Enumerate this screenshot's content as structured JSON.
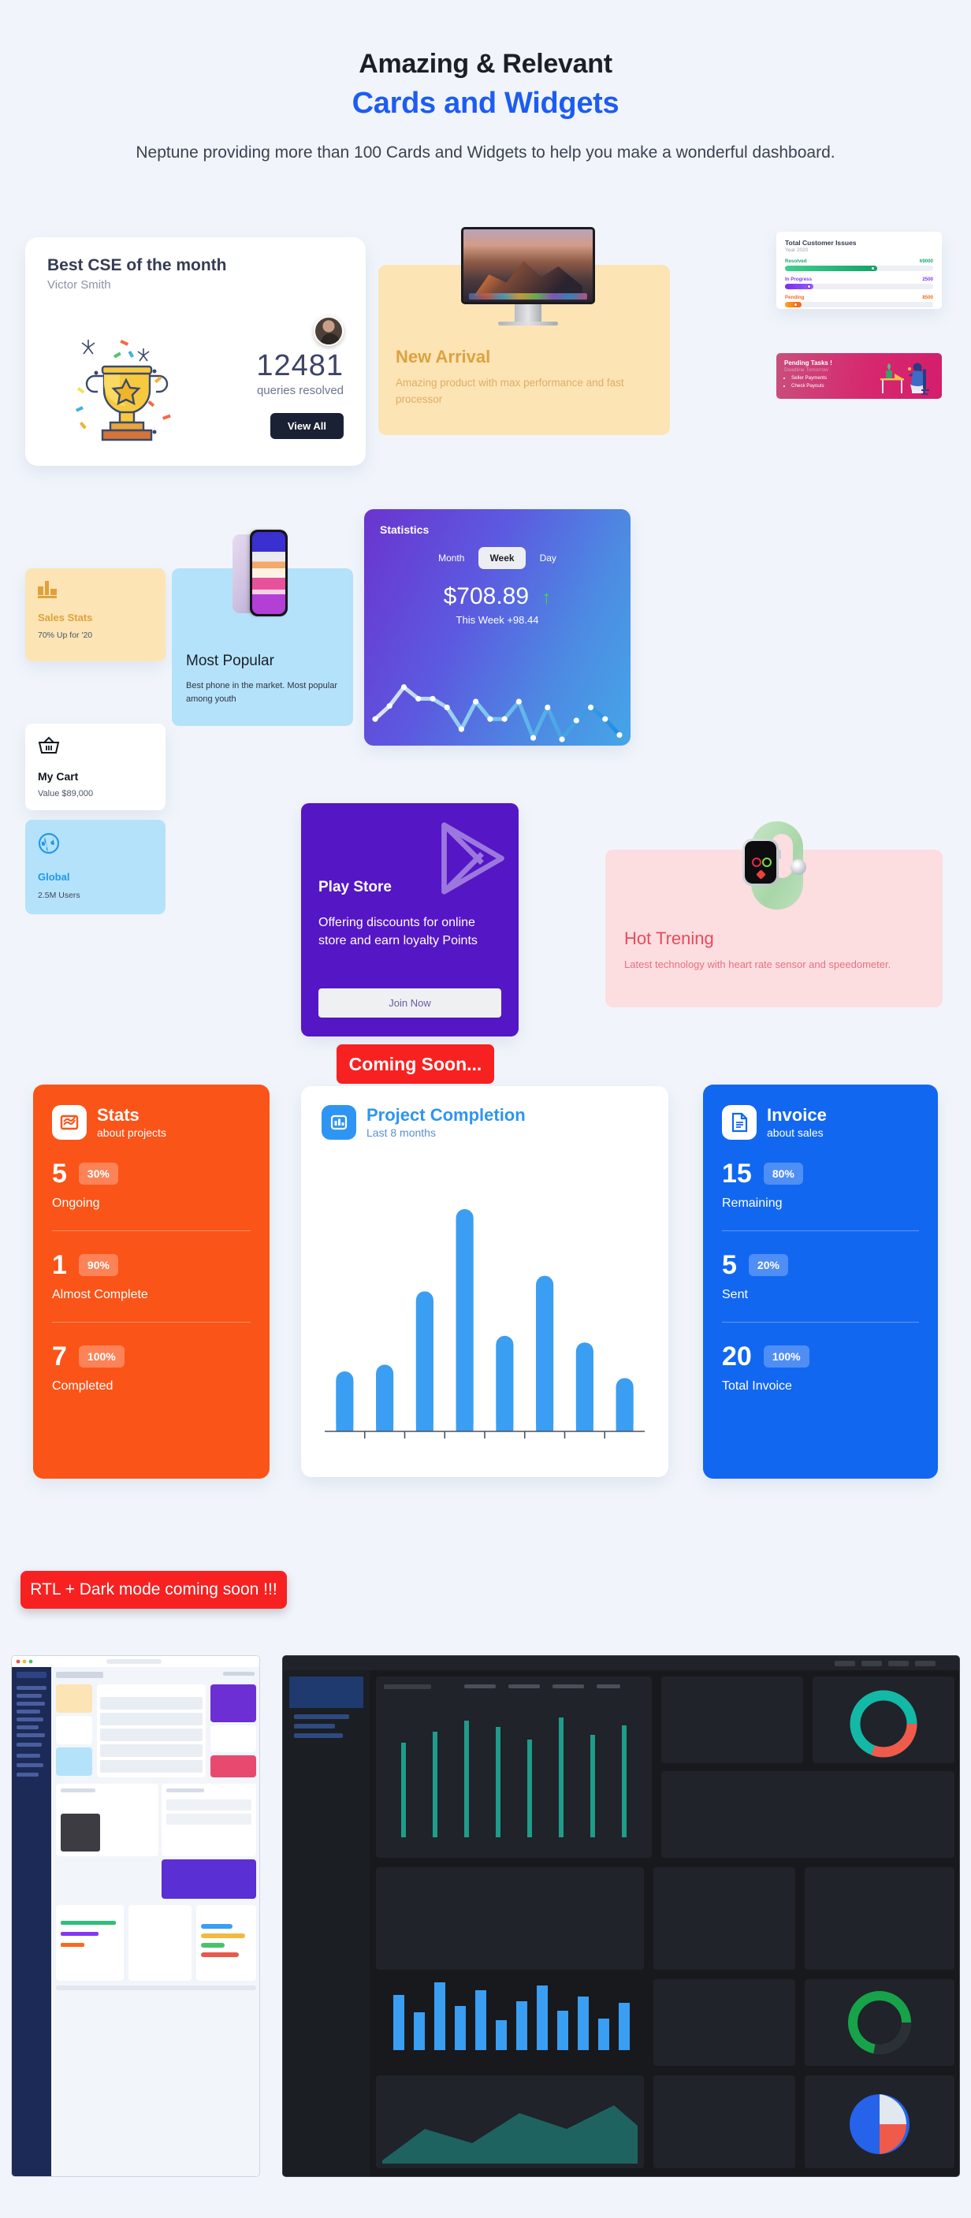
{
  "header": {
    "eyebrow": "Amazing & Relevant",
    "title": "Cards and Widgets",
    "description": "Neptune providing more than 100 Cards and Widgets to help you make a wonderful dashboard."
  },
  "cse_card": {
    "title": "Best CSE of the month",
    "name": "Victor Smith",
    "count": "12481",
    "count_label": "queries resolved",
    "button": "View All"
  },
  "new_arrival": {
    "title": "New Arrival",
    "description": "Amazing product with max performance and fast processor"
  },
  "issues_card": {
    "title": "Total Customer Issues",
    "year": "Year 2020",
    "rows": [
      {
        "label": "Resolved",
        "value": "69000",
        "pct": 62,
        "color": "#20a970"
      },
      {
        "label": "In Progress",
        "value": "2500",
        "pct": 19,
        "color": "#8438f5"
      },
      {
        "label": "Pending",
        "value": "8500",
        "pct": 10,
        "color": "#fb6a1b"
      }
    ]
  },
  "pending_card": {
    "title": "Pending Tasks !",
    "subtitle": "Deadline Tomorrow",
    "items": [
      "Seller Payments",
      "Check Payouts"
    ]
  },
  "sales_stats": {
    "title": "Sales Stats",
    "subtitle": "70% Up for '20",
    "icon": "bar-chart-icon"
  },
  "cart_card": {
    "title": "My Cart",
    "subtitle": "Value $89,000",
    "icon": "basket-icon"
  },
  "global_card": {
    "title": "Global",
    "subtitle": "2.5M Users",
    "icon": "globe-icon"
  },
  "popular_card": {
    "title": "Most Popular",
    "subtitle": "Best phone in the market. Most popular among youth"
  },
  "statistics": {
    "title": "Statistics",
    "tabs": [
      "Month",
      "Week",
      "Day"
    ],
    "active_tab": "Week",
    "amount": "$708.89",
    "trend_arrow": "↑",
    "trend_color": "#46d934",
    "sub": "This Week +98.44"
  },
  "play_store": {
    "title": "Play Store",
    "description": "Offering discounts for online store and earn loyalty Points",
    "button": "Join Now",
    "icon": "play-store-icon"
  },
  "hot_card": {
    "title": "Hot Trening",
    "description": "Latest technology with heart rate sensor and speedometer."
  },
  "stats_card": {
    "title": "Stats",
    "subtitle": "about projects",
    "icon": "chart-icon",
    "items": [
      {
        "number": "5",
        "pct": "30%",
        "label": "Ongoing"
      },
      {
        "number": "1",
        "pct": "90%",
        "label": "Almost Complete"
      },
      {
        "number": "7",
        "pct": "100%",
        "label": "Completed"
      }
    ]
  },
  "invoice_card": {
    "title": "Invoice",
    "subtitle": "about sales",
    "icon": "document-icon",
    "items": [
      {
        "number": "15",
        "pct": "80%",
        "label": "Remaining"
      },
      {
        "number": "5",
        "pct": "20%",
        "label": "Sent"
      },
      {
        "number": "20",
        "pct": "100%",
        "label": "Total Invoice"
      }
    ]
  },
  "project_card": {
    "title": "Project Completion",
    "subtitle": "Last 8 months",
    "icon": "bar-chart-icon"
  },
  "rtl_banner": {
    "text": "RTL + Dark mode coming soon !!!"
  },
  "coming_soon": {
    "text": "Coming Soon..."
  },
  "chart_data": [
    {
      "type": "bar",
      "title": "Project Completion",
      "subtitle": "Last 8 months",
      "categories": [
        "1",
        "2",
        "3",
        "4",
        "5",
        "6",
        "7",
        "8"
      ],
      "values": [
        27,
        30,
        63,
        100,
        43,
        70,
        40,
        24
      ],
      "ylim": [
        0,
        100
      ],
      "xlabel": "",
      "ylabel": "",
      "grid": false,
      "legend": null,
      "color": "#3a9ef2"
    },
    {
      "type": "line",
      "title": "Statistics",
      "values": [
        28,
        46,
        72,
        56,
        56,
        44,
        14,
        52,
        28,
        28,
        52,
        2,
        44,
        0,
        26,
        44,
        28,
        6
      ],
      "ylim": [
        0,
        100
      ],
      "grid": false,
      "annotation": "$708.89 — This Week +98.44"
    }
  ]
}
